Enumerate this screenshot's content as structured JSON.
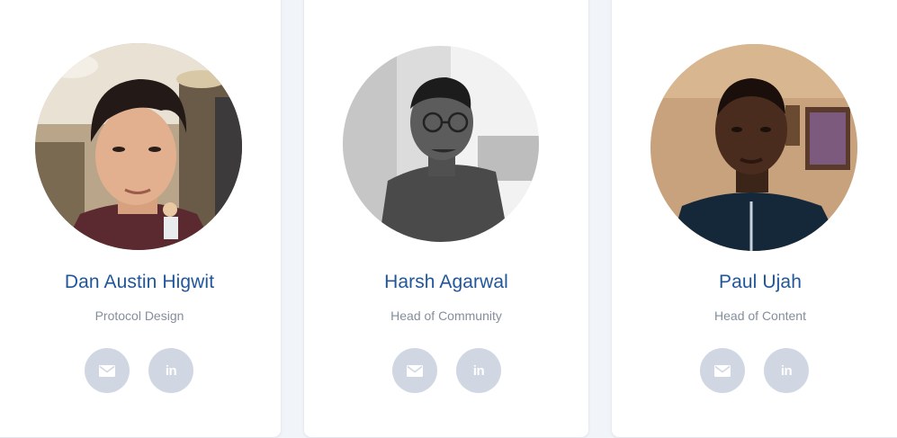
{
  "team": [
    {
      "name": "Dan Austin Higwit",
      "role": "Protocol Design",
      "photo_icon": "portrait-photo-color",
      "mail_icon": "envelope-icon",
      "linkedin_icon": "linkedin-icon",
      "linkedin_text": "in"
    },
    {
      "name": "Harsh Agarwal",
      "role": "Head of Community",
      "photo_icon": "portrait-photo-grayscale",
      "mail_icon": "envelope-icon",
      "linkedin_icon": "linkedin-icon",
      "linkedin_text": "in"
    },
    {
      "name": "Paul Ujah",
      "role": "Head of Content",
      "photo_icon": "portrait-photo-color",
      "mail_icon": "envelope-icon",
      "linkedin_icon": "linkedin-icon",
      "linkedin_text": "in"
    }
  ],
  "colors": {
    "page_background": "#f1f4f8",
    "card_background": "#ffffff",
    "name_color": "#22569a",
    "role_color": "#848e9c",
    "social_button_bg": "#d0d7e3",
    "social_icon_color": "#ffffff"
  }
}
